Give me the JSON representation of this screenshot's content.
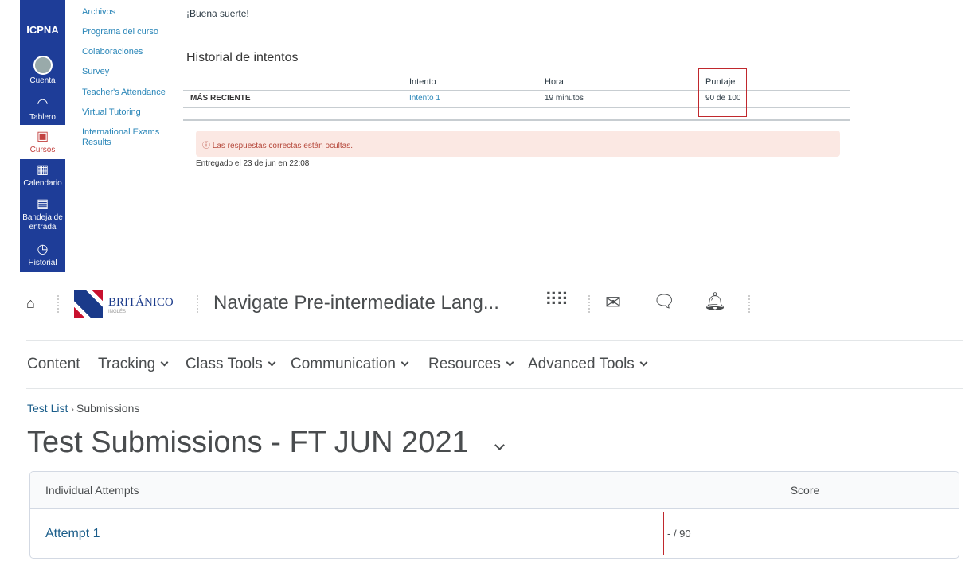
{
  "canvas": {
    "global_nav": {
      "logo": "ICPNA",
      "items": [
        {
          "label": "Cuenta",
          "icon": "user-avatar-icon"
        },
        {
          "label": "Tablero",
          "icon": "dashboard-icon"
        },
        {
          "label": "Cursos",
          "icon": "book-icon",
          "active": true
        },
        {
          "label": "Calendario",
          "icon": "calendar-icon"
        },
        {
          "label": "Bandeja de entrada",
          "icon": "inbox-icon"
        },
        {
          "label": "Historial",
          "icon": "clock-icon"
        }
      ]
    },
    "course_nav": [
      "Archivos",
      "Programa del curso",
      "Colaboraciones",
      "Survey",
      "Teacher's Attendance",
      "Virtual Tutoring",
      "International Exams Results"
    ],
    "good_luck": "¡Buena suerte!",
    "history_title": "Historial de intentos",
    "table": {
      "headers": [
        "",
        "Intento",
        "Hora",
        "Puntaje"
      ],
      "row": [
        "MÁS RECIENTE",
        "Intento 1",
        "19 minutos",
        "90 de 100"
      ]
    },
    "alert": "Las respuestas correctas están ocultas.",
    "submitted": "Entregado el 23 de jun en 22:08",
    "highlight_color": "#c0282d"
  },
  "brightspace": {
    "logo": "BRITÁNICO",
    "logo_sub": "INGLÉS",
    "course_title": "Navigate Pre-intermediate Lang...",
    "menu": [
      {
        "label": "Content",
        "dropdown": false
      },
      {
        "label": "Tracking",
        "dropdown": true
      },
      {
        "label": "Class Tools",
        "dropdown": true
      },
      {
        "label": "Communication",
        "dropdown": true
      },
      {
        "label": "Resources",
        "dropdown": true
      },
      {
        "label": "Advanced Tools",
        "dropdown": true
      }
    ],
    "breadcrumb": {
      "link": "Test List",
      "current": "Submissions"
    },
    "page_title": "Test Submissions - FT JUN 2021",
    "table": {
      "headers": [
        "Individual Attempts",
        "Score"
      ],
      "row": {
        "attempt": "Attempt 1",
        "score": "- / 90"
      }
    }
  }
}
